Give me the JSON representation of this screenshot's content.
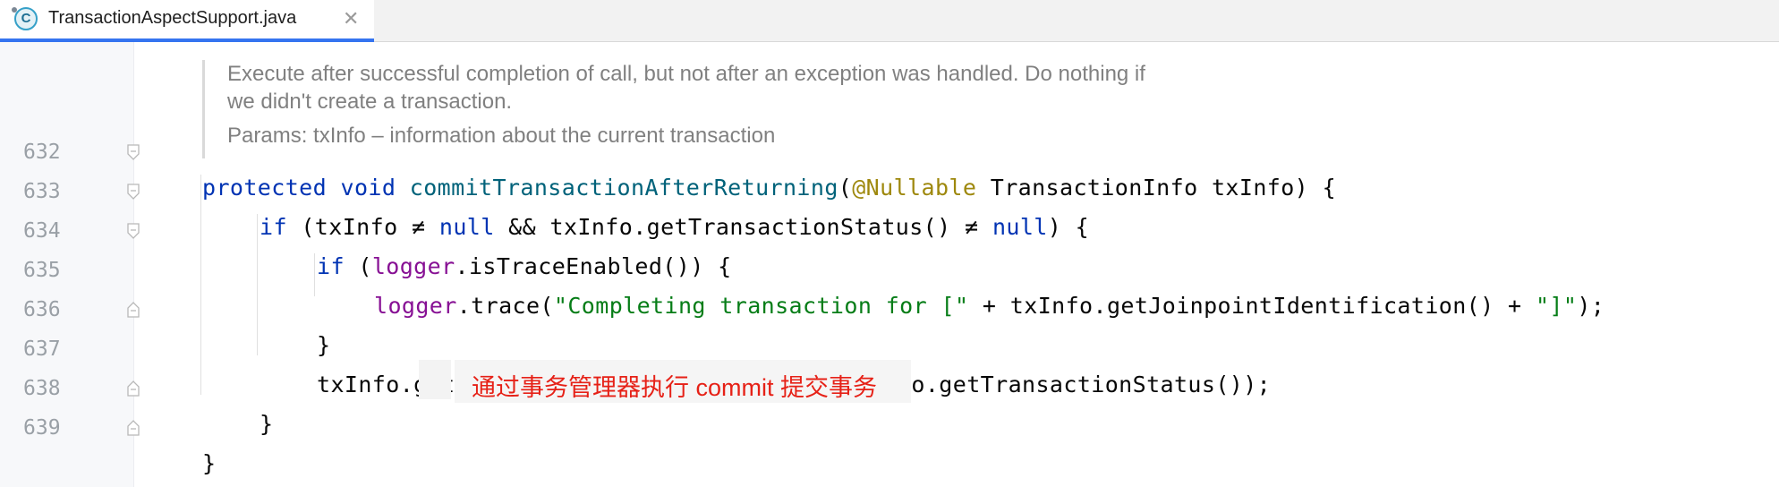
{
  "tab": {
    "file_name": "TransactionAspectSupport.java",
    "icon_letter": "C",
    "close_glyph": "✕"
  },
  "doc": {
    "line1": "Execute after successful completion of call, but not after an exception was handled. Do nothing if",
    "line2": "we didn't create a transaction.",
    "params": "Params: txInfo – information about the current transaction"
  },
  "line_numbers": [
    "632",
    "633",
    "634",
    "635",
    "636",
    "637",
    "638",
    "639"
  ],
  "code": {
    "l632": {
      "kw1": "protected",
      "kw2": "void",
      "method": "commitTransactionAfterReturning",
      "paren": "(",
      "annotation": "@Nullable",
      "rest": " TransactionInfo txInfo) {"
    },
    "l633": {
      "kw_if": "if",
      "p1": " (txInfo ≠ ",
      "null1": "null",
      "p2": " && txInfo.getTransactionStatus() ≠ ",
      "null2": "null",
      "p3": ") {"
    },
    "l634": {
      "kw_if": "if",
      "p1": " (",
      "field": "logger",
      "p2": ".isTraceEnabled()) {"
    },
    "l635": {
      "field": "logger",
      "p1": ".trace(",
      "str1": "\"Completing transaction for [\"",
      "p2": " + txInfo.getJoinpointIdentification() + ",
      "str2": "\"]\"",
      "p3": ");"
    },
    "l636": "}",
    "l637": "txInfo.getTransactionManager().commit(txInfo.getTransactionStatus());",
    "l638": "}",
    "l639": "}"
  },
  "annotation": {
    "text": "通过事务管理器执行 commit 提交事务",
    "color": "#e62117"
  },
  "colors": {
    "keyword": "#0033b3",
    "method": "#00627a",
    "annotation": "#9e880d",
    "field": "#871094",
    "string": "#067d17",
    "tab_underline": "#3574f0"
  }
}
